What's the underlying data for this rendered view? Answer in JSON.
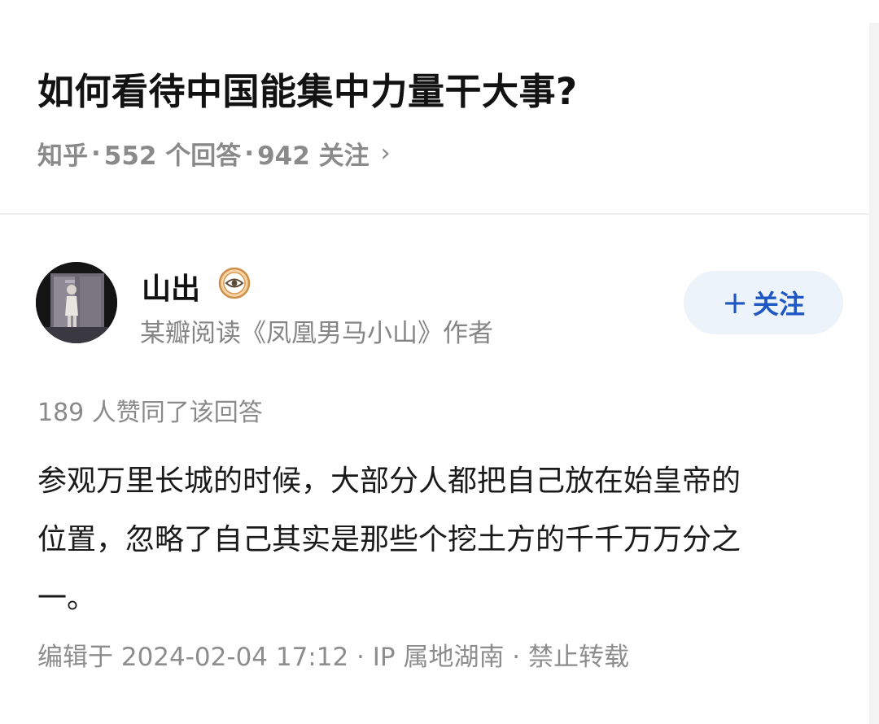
{
  "question": {
    "title": "如何看待中国能集中力量干大事?",
    "source": "知乎",
    "answers": "552 个回答",
    "followers": "942 关注",
    "chevron": "›"
  },
  "author": {
    "name": "山出",
    "bio": "某瓣阅读《凤凰男马小山》作者",
    "follow_label": "关注",
    "follow_icon": "plus-icon",
    "badge_icon": "eye-badge-icon"
  },
  "answer": {
    "upvote_text": "189 人赞同了该回答",
    "lines": [
      "参观万里长城的时候，大部分人都把自己放在始皇帝的",
      "位置，忽略了自己其实是那些个挖土方的千千万万分之",
      "一。"
    ],
    "footer": "编辑于 2024-02-04 17:12 · IP 属地湖南 · 禁止转载"
  },
  "colors": {
    "accent": "#1e57c4",
    "follow_bg": "#edf3fb",
    "meta_gray": "#8a8a8a",
    "badge_orange": "#e0a458"
  }
}
